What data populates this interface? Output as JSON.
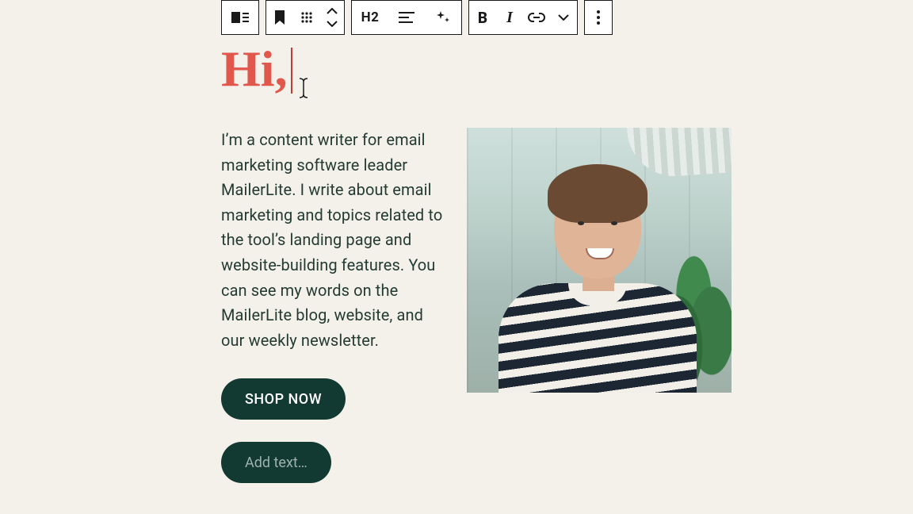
{
  "toolbar": {
    "block_type_icon": "block-type",
    "bookmark_icon": "bookmark",
    "drag_icon": "drag-handle",
    "move_up_icon": "chevron-up",
    "move_down_icon": "chevron-down",
    "heading_level": "H2",
    "align_icon": "align-left",
    "ai_icon": "ai-sparkle",
    "bold_label": "B",
    "italic_label": "I",
    "link_icon": "link",
    "dropdown_icon": "chevron-down",
    "more_icon": "more-vertical"
  },
  "content": {
    "heading": "Hi,",
    "body": "I’m a content writer for email marketing software leader MailerLite. I write about email marketing and topics related to the tool’s landing page and website-building features. You can see my words on the MailerLite blog, website, and our weekly newsletter.",
    "cta_label": "SHOP NOW",
    "add_text_placeholder": "Add text…",
    "image_alt": "Smiling person in striped shirt in front of glass building and plants"
  },
  "colors": {
    "page_bg": "#f4f1ea",
    "heading": "#e2574c",
    "body_text": "#243b33",
    "button_bg": "#123a32",
    "button_text": "#ffffff",
    "placeholder": "#9db3ad",
    "toolbar_border": "#1a1a1a"
  }
}
